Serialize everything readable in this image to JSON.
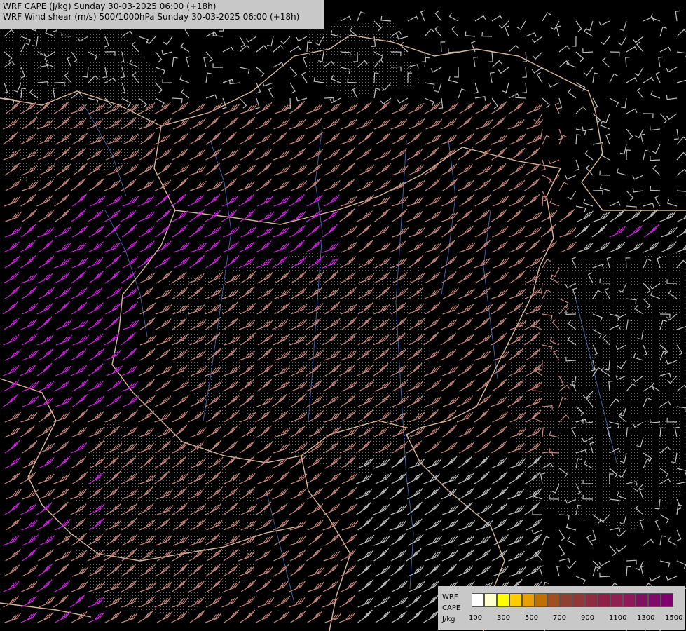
{
  "header": {
    "line1": "WRF CAPE (J/kg) Sunday 30-03-2025 06:00 (+18h)",
    "line2": "WRF Wind shear (m/s) 500/1000hPa Sunday 30-03-2025 06:00 (+18h)"
  },
  "legend": {
    "label_model": "WRF",
    "label_var": "CAPE",
    "label_unit": "J/kg",
    "ticks": [
      "100",
      "300",
      "500",
      "700",
      "900",
      "1100",
      "1300",
      "1500"
    ],
    "colors": [
      "#ffffff",
      "#ffffcc",
      "#ffff00",
      "#ffcc00",
      "#e8a000",
      "#c07000",
      "#a05020",
      "#904030",
      "#903838",
      "#902c40",
      "#902048",
      "#902050",
      "#901858",
      "#801060",
      "#800a6a",
      "#800070"
    ]
  },
  "map_colors": {
    "background": "#000000",
    "border": "#d8b898",
    "river": "#4060a0",
    "shear_low": "#c0c0c0",
    "shear_mid": "#c88880",
    "shear_high": "#e08878",
    "shear_extreme": "#d020e0"
  }
}
